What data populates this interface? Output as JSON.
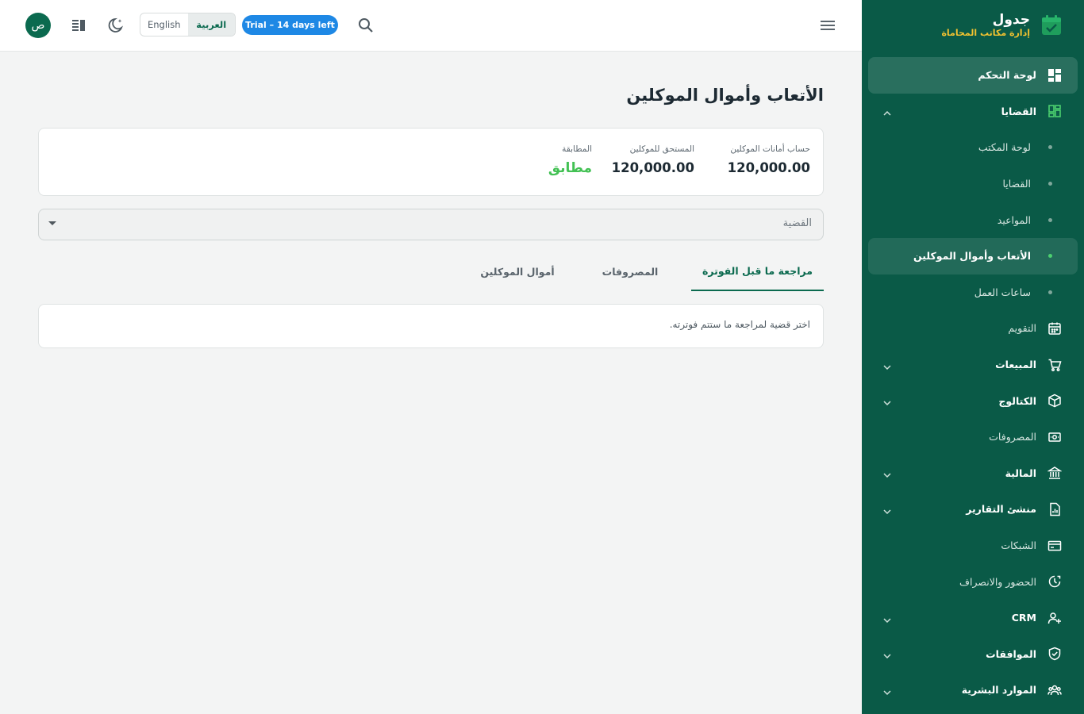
{
  "brand": {
    "title": "جدول",
    "subtitle": "إدارة مكاتب المحاماة"
  },
  "topbar": {
    "avatar_initial": "ص",
    "lang_english": "English",
    "lang_arabic": "العربية",
    "trial_label": "Trial – 14 days left"
  },
  "sidebar": {
    "items": [
      {
        "label": "لوحة التحكم",
        "icon": "dashboard-icon",
        "state": "active"
      },
      {
        "label": "القضايا",
        "icon": "cases-grid-icon",
        "expanded": true
      },
      {
        "label": "لوحة المكتب",
        "sub": true
      },
      {
        "label": "القضايا",
        "sub": true
      },
      {
        "label": "المواعيد",
        "sub": true
      },
      {
        "label": "الأتعاب وأموال الموكلين",
        "sub": true,
        "state": "active"
      },
      {
        "label": "ساعات العمل",
        "sub": true
      },
      {
        "label": "التقويم",
        "icon": "calendar-icon"
      },
      {
        "label": "المبيعات",
        "icon": "cart-icon",
        "expandable": true
      },
      {
        "label": "الكتالوج",
        "icon": "box-icon",
        "expandable": true
      },
      {
        "label": "المصروفات",
        "icon": "cash-icon"
      },
      {
        "label": "المالية",
        "icon": "bank-icon",
        "expandable": true
      },
      {
        "label": "منشئ التقارير",
        "icon": "report-icon",
        "expandable": true
      },
      {
        "label": "الشبكات",
        "icon": "card-icon"
      },
      {
        "label": "الحضور والانصراف",
        "icon": "clock-icon"
      },
      {
        "label": "CRM",
        "icon": "user-plus-icon",
        "expandable": true
      },
      {
        "label": "الموافقات",
        "icon": "shield-check-icon",
        "expandable": true
      },
      {
        "label": "الموارد البشرية",
        "icon": "people-icon",
        "expandable": true
      }
    ]
  },
  "main": {
    "title": "الأتعاب وأموال الموكلين",
    "summary": {
      "trust_label": "حساب أمانات الموكلين",
      "trust_value": "120,000.00",
      "due_label": "المستحق للموكلين",
      "due_value": "120,000.00",
      "match_label": "المطابقة",
      "match_value": "مطابق"
    },
    "case_select_label": "القضية",
    "tabs": [
      {
        "label": "مراجعة ما قبل الفوترة",
        "active": true
      },
      {
        "label": "المصروفات"
      },
      {
        "label": "أموال الموكلين"
      }
    ],
    "empty_message": "اختر قضية لمراجعة ما ستتم فوترته."
  },
  "colors": {
    "sidebar_bg": "#0a5a47",
    "accent": "#0b6a4f",
    "trial_badge": "#1e88e5",
    "match_green": "#43c154",
    "brand_sub": "#f2c230"
  }
}
